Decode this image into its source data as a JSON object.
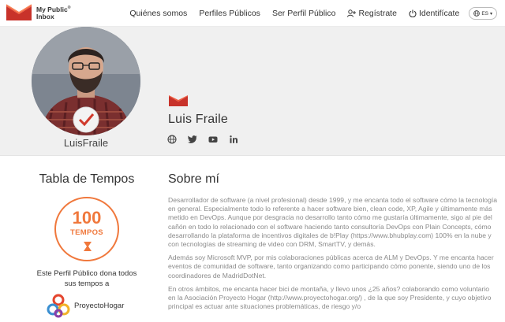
{
  "header": {
    "brand_line1": "My Public",
    "brand_line2": "Inbox",
    "nav": [
      {
        "label": "Quiénes somos"
      },
      {
        "label": "Perfiles Públicos"
      },
      {
        "label": "Ser Perfil Público"
      },
      {
        "label": "Regístrate"
      },
      {
        "label": "Identifícate"
      }
    ],
    "language": "ES"
  },
  "profile": {
    "username": "LuisFraile",
    "full_name": "Luis Fraile",
    "social_icons": [
      "globe-icon",
      "twitter-icon",
      "youtube-icon",
      "linkedin-icon"
    ],
    "accent_color": "#e8432d"
  },
  "tempos": {
    "title": "Tabla de Tempos",
    "count": "100",
    "unit": "TEMPOS",
    "donation_text": "Este Perfil Público dona todos sus tempos a",
    "partner_name": "ProyectoHogar",
    "accent_color": "#f0783c"
  },
  "about": {
    "title": "Sobre mí",
    "paragraphs": [
      "Desarrollador de software (a nivel profesional) desde 1999, y me encanta todo el software cómo la tecnología en general. Especialmente todo lo referente a hacer software bien, clean code, XP, Agile y últimamente más metido en DevOps. Aunque por desgracia no desarrollo tanto cómo me gustaría últimamente, sigo al pie del cañón en todo lo relacionado con el software haciendo tanto consultoría DevOps con Plain Concepts, cómo desarrollando la plataforma de incentivos digitales de b!Play (https://www.bhubplay.com) 100% en la nube y con tecnologías de streaming de video con DRM, SmartTV, y demás.",
      "Además soy Microsoft MVP, por mis colaboraciones públicas acerca de ALM y DevOps. Y me encanta hacer eventos de comunidad de software, tanto organizando como participando cómo ponente, siendo uno de los coordinadores de MadridDotNet.",
      "En otros ámbitos, me encanta hacer bici de montaña, y llevo unos ¿25 años? colaborando como voluntario en la Asociación Proyecto Hogar (http://www.proyectohogar.org/) , de la que soy Presidente, y cuyo objetivo principal es actuar ante situaciones problemáticas, de riesgo y/o"
    ]
  }
}
